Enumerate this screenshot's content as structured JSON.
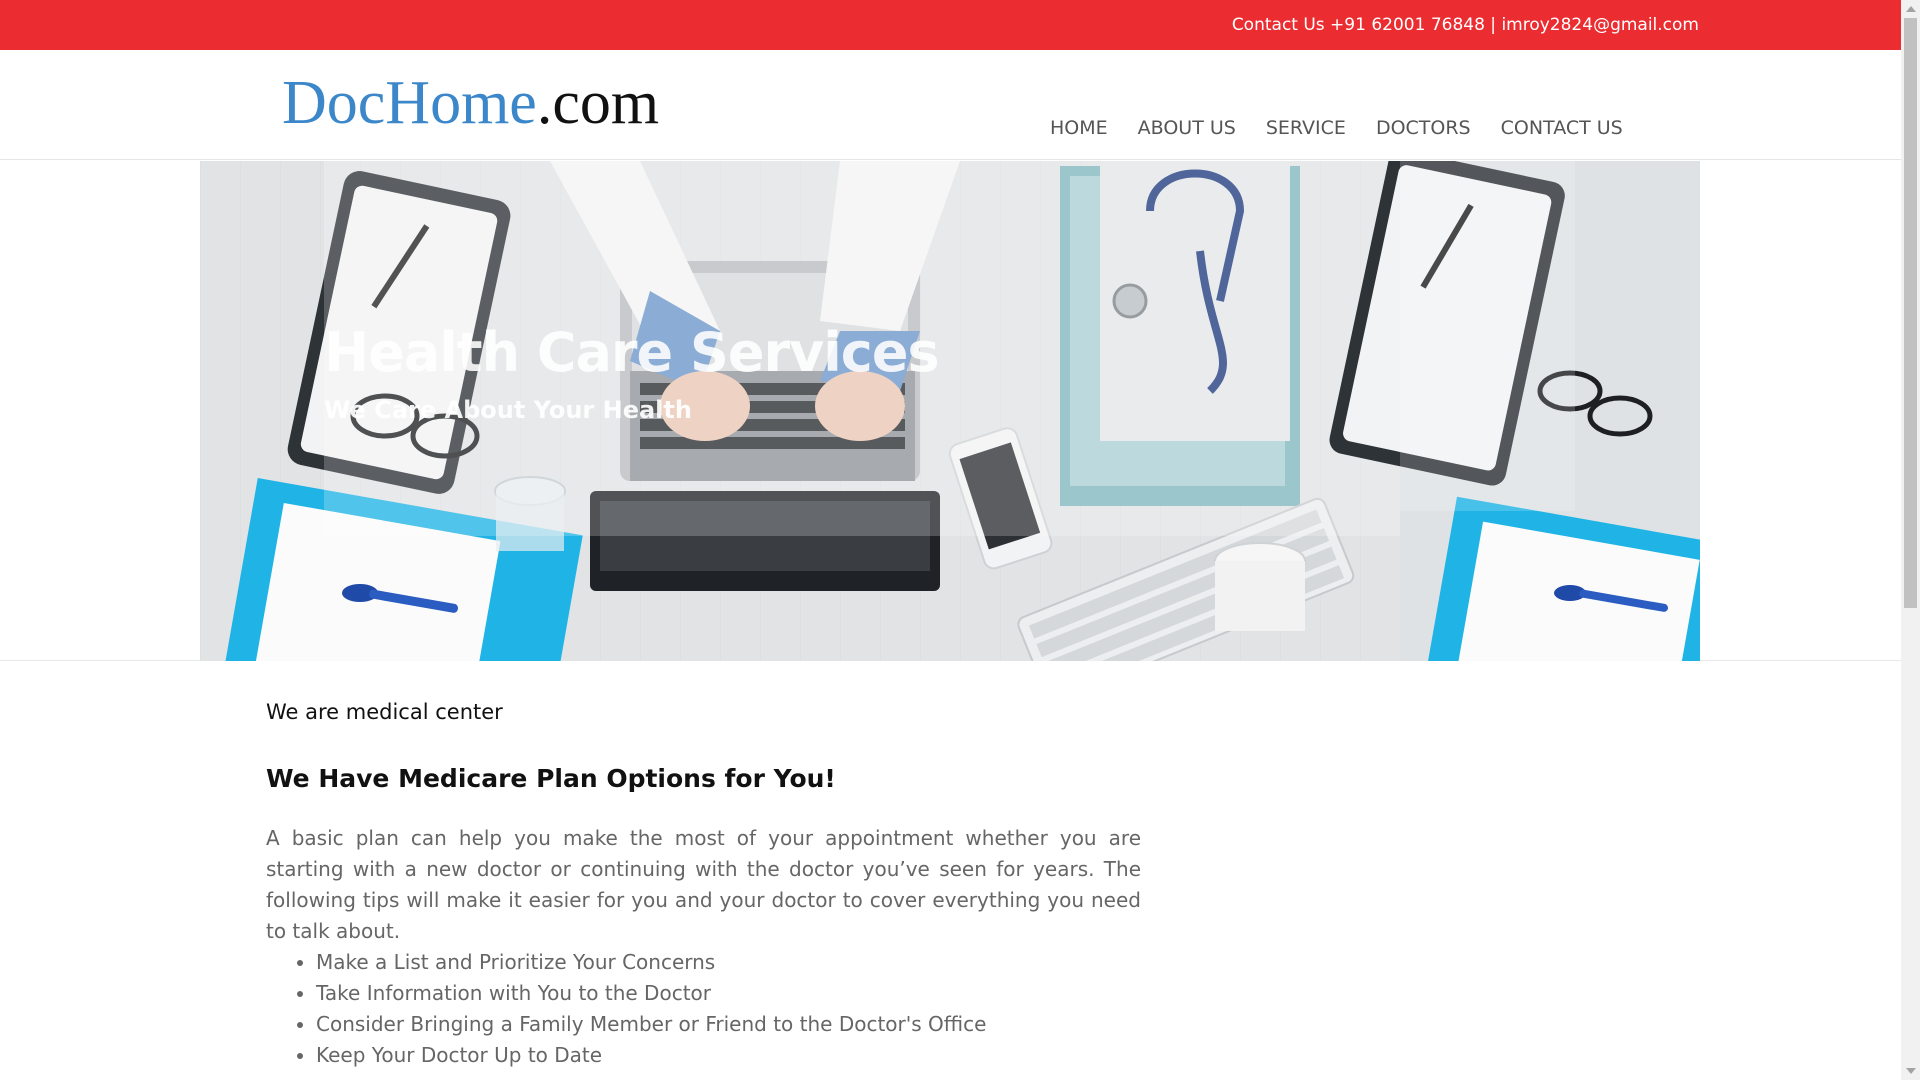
{
  "topbar": {
    "contact_text": "Contact Us +91 62001 76848 | imroy2824@gmail.com",
    "background": "#eb2d31"
  },
  "header": {
    "logo_brand": "DocHome",
    "logo_tld": ".com",
    "brand_color": "#3b87c9",
    "nav": [
      {
        "label": "HOME"
      },
      {
        "label": "ABOUT US"
      },
      {
        "label": "SERVICE"
      },
      {
        "label": "DOCTORS"
      },
      {
        "label": "CONTACT US"
      }
    ]
  },
  "hero": {
    "title": "Health Care Services",
    "subtitle": "We Care About Your Health"
  },
  "content": {
    "kicker": "We are medical center",
    "headline": "We Have Medicare Plan Options for You!",
    "paragraph": "A basic plan can help you make the most of your appointment whether you are starting with a new doctor or continuing with the doctor you’ve seen for years. The following tips will make it easier for you and your doctor to cover everything you need to talk about.",
    "tips": [
      "Make a List and Prioritize Your Concerns",
      "Take Information with You to the Doctor",
      "Consider Bringing a Family Member or Friend to the Doctor's Office",
      "Keep Your Doctor Up to Date"
    ]
  }
}
